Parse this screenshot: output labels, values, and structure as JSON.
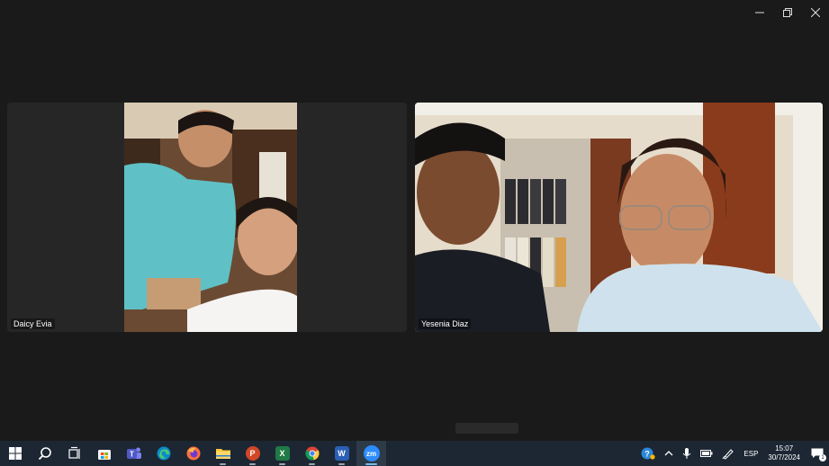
{
  "window": {
    "controls": [
      {
        "name": "minimize-icon"
      },
      {
        "name": "restore-icon"
      },
      {
        "name": "close-icon"
      }
    ]
  },
  "participants": [
    {
      "name": "Daicy Evia"
    },
    {
      "name": "Yesenia Diaz"
    }
  ],
  "taskbar": {
    "apps": [
      "windows-start",
      "search",
      "task-view",
      "microsoft-store",
      "teams",
      "edge",
      "firefox",
      "file-explorer",
      "powerpoint",
      "excel",
      "chrome",
      "word",
      "zoom"
    ],
    "zoom_label": "zm",
    "word_label": "W",
    "powerpoint_label": "P",
    "excel_label": "X"
  },
  "tray": {
    "language": "ESP",
    "time": "15:07",
    "date": "30/7/2024",
    "notification_count": "1"
  },
  "colors": {
    "background": "#1a1a1a",
    "tile": "#262626",
    "taskbar": "#1c2733",
    "active_indicator": "#76b9ed"
  }
}
